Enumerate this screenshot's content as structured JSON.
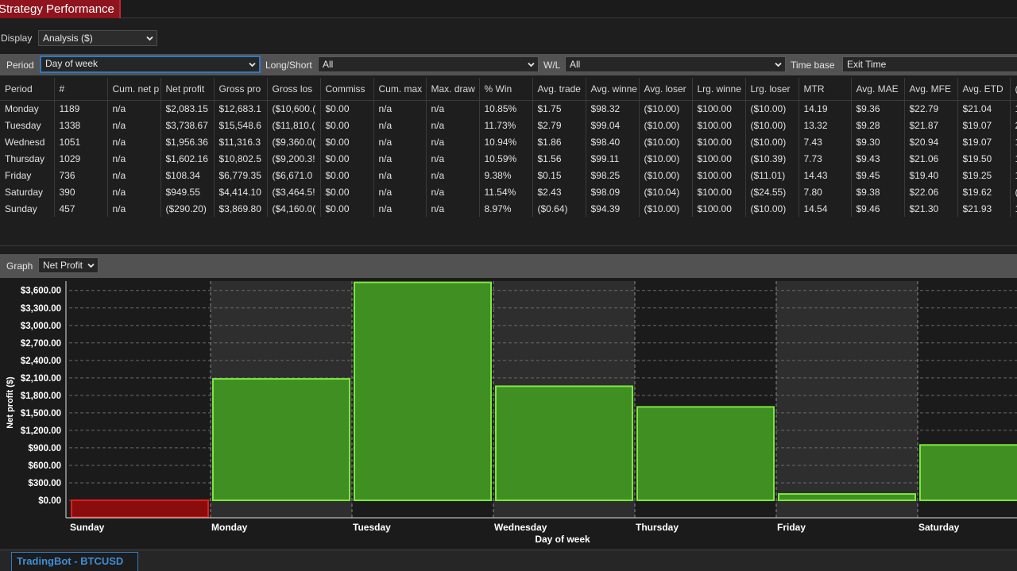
{
  "window": {
    "title": "Strategy Performance"
  },
  "display": {
    "label": "Display",
    "value": "Analysis ($)"
  },
  "filters": {
    "period_label": "Period",
    "period_value": "Day of week",
    "longshort_label": "Long/Short",
    "longshort_value": "All",
    "wl_label": "W/L",
    "wl_value": "All",
    "timebase_label": "Time base",
    "timebase_value": "Exit Time"
  },
  "table": {
    "columns": [
      "Period",
      "#",
      "Cum. net p",
      "Net profit",
      "Gross pro",
      "Gross los",
      "Commiss",
      "Cum. max",
      "Max. draw",
      "% Win",
      "Avg. trade",
      "Avg. winne",
      "Avg. loser",
      "Lrg. winne",
      "Lrg. loser",
      "MTR",
      "Avg. MAE",
      "Avg. MFE",
      "Avg. ETD",
      "("
    ],
    "rows": [
      [
        "Monday",
        "1189",
        "n/a",
        "$2,083.15",
        "$12,683.1",
        "($10,600.(",
        "$0.00",
        "n/a",
        "n/a",
        "10.85%",
        "$1.75",
        "$98.32",
        "($10.00)",
        "$100.00",
        "($10.00)",
        "14.19",
        "$9.36",
        "$22.79",
        "$21.04",
        "1"
      ],
      [
        "Tuesday",
        "1338",
        "n/a",
        "$3,738.67",
        "$15,548.6",
        "($11,810.(",
        "$0.00",
        "n/a",
        "n/a",
        "11.73%",
        "$2.79",
        "$99.04",
        "($10.00)",
        "$100.00",
        "($10.00)",
        "13.32",
        "$9.28",
        "$21.87",
        "$19.07",
        "2"
      ],
      [
        "Wednesd",
        "1051",
        "n/a",
        "$1,956.36",
        "$11,316.3",
        "($9,360.0(",
        "$0.00",
        "n/a",
        "n/a",
        "10.94%",
        "$1.86",
        "$98.40",
        "($10.00)",
        "$100.00",
        "($10.00)",
        "7.43",
        "$9.30",
        "$20.94",
        "$19.07",
        "1"
      ],
      [
        "Thursday",
        "1029",
        "n/a",
        "$1,602.16",
        "$10,802.5",
        "($9,200.3!",
        "$0.00",
        "n/a",
        "n/a",
        "10.59%",
        "$1.56",
        "$99.11",
        "($10.00)",
        "$100.00",
        "($10.39)",
        "7.73",
        "$9.43",
        "$21.06",
        "$19.50",
        "1"
      ],
      [
        "Friday",
        "736",
        "n/a",
        "$108.34",
        "$6,779.35",
        "($6,671.0",
        "$0.00",
        "n/a",
        "n/a",
        "9.38%",
        "$0.15",
        "$98.25",
        "($10.00)",
        "$100.00",
        "($11.01)",
        "14.43",
        "$9.45",
        "$19.40",
        "$19.25",
        "1"
      ],
      [
        "Saturday",
        "390",
        "n/a",
        "$949.55",
        "$4,414.10",
        "($3,464.5!",
        "$0.00",
        "n/a",
        "n/a",
        "11.54%",
        "$2.43",
        "$98.09",
        "($10.04)",
        "$100.00",
        "($24.55)",
        "7.80",
        "$9.38",
        "$22.06",
        "$19.62",
        "("
      ],
      [
        "Sunday",
        "457",
        "n/a",
        "($290.20)",
        "$3,869.80",
        "($4,160.0(",
        "$0.00",
        "n/a",
        "n/a",
        "8.97%",
        "($0.64)",
        "$94.39",
        "($10.00)",
        "$100.00",
        "($10.00)",
        "14.54",
        "$9.46",
        "$21.30",
        "$21.93",
        "1"
      ]
    ]
  },
  "graph": {
    "label": "Graph",
    "value": "Net Profit"
  },
  "colors": {
    "positive_fill": "#3f8f22",
    "positive_stroke": "#7de83f",
    "negative_fill": "#8a0c0c",
    "negative_stroke": "#e01e1e"
  },
  "chart_data": {
    "type": "bar",
    "xlabel": "Day of week",
    "ylabel": "Net profit ($)",
    "categories": [
      "Sunday",
      "Monday",
      "Tuesday",
      "Wednesday",
      "Thursday",
      "Friday",
      "Saturday"
    ],
    "values": [
      -290.2,
      2083.15,
      3738.67,
      1956.36,
      1602.16,
      108.34,
      949.55
    ],
    "yticks": [
      "$0.00",
      "$300.00",
      "$600.00",
      "$900.00",
      "$1,200.00",
      "$1,500.00",
      "$1,800.00",
      "$2,100.00",
      "$2,400.00",
      "$2,700.00",
      "$3,000.00",
      "$3,300.00",
      "$3,600.00"
    ],
    "ylim": [
      -300,
      3760
    ],
    "grid": true
  },
  "status": {
    "tab_label": "TradingBot - BTCUSD"
  }
}
